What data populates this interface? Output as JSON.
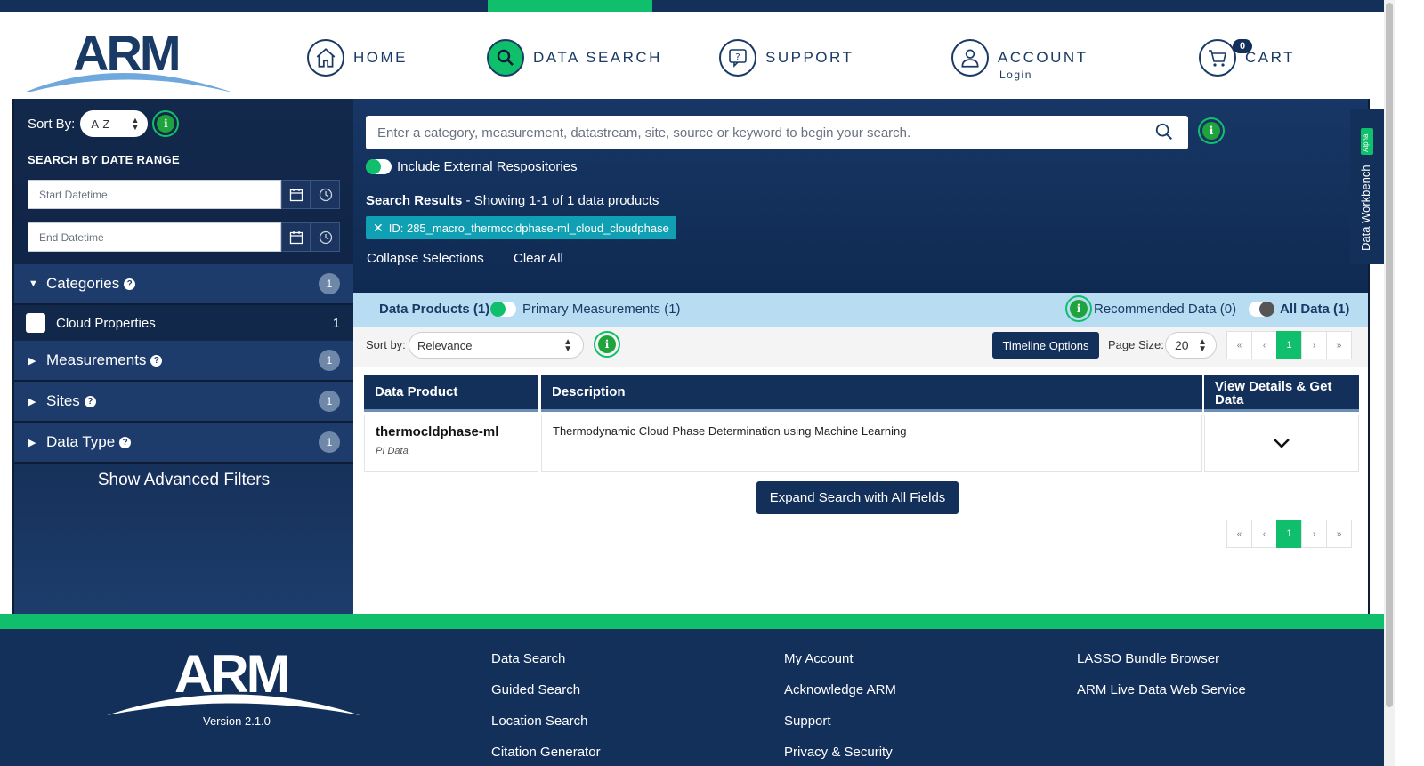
{
  "header": {
    "logo_text": "ARM",
    "nav": [
      {
        "label": "HOME"
      },
      {
        "label": "DATA SEARCH"
      },
      {
        "label": "SUPPORT"
      },
      {
        "label": "ACCOUNT",
        "sub": "Login"
      },
      {
        "label": "CART",
        "badge": "0"
      }
    ]
  },
  "sidebar": {
    "sort_label": "Sort By:",
    "sort_value": "A-Z",
    "date_title": "SEARCH BY DATE RANGE",
    "start_placeholder": "Start Datetime",
    "end_placeholder": "End Datetime",
    "facets": [
      {
        "name": "Categories",
        "count": "1",
        "expanded": true
      },
      {
        "name": "Measurements",
        "count": "1",
        "expanded": false
      },
      {
        "name": "Sites",
        "count": "1",
        "expanded": false
      },
      {
        "name": "Data Type",
        "count": "1",
        "expanded": false
      }
    ],
    "category_item": {
      "name": "Cloud Properties",
      "count": "1"
    },
    "advanced_filters": "Show Advanced Filters"
  },
  "search": {
    "placeholder": "Enter a category, measurement, datastream, site, source or keyword to begin your search.",
    "include_external": "Include External Respositories",
    "results_label": "Search Results",
    "results_summary": " - Showing 1-1 of 1 data products",
    "chip": "ID: 285_macro_thermocldphase-ml_cloud_cloudphase",
    "collapse": "Collapse Selections",
    "clear_all": "Clear All"
  },
  "tabs": {
    "data_products": "Data Products (1)",
    "primary_measurements": "Primary Measurements (1)",
    "recommended": "Recommended Data (0)",
    "all_data": "All Data (1)"
  },
  "sortbar": {
    "label": "Sort by:",
    "value": "Relevance",
    "timeline": "Timeline Options",
    "page_size_label": "Page Size:",
    "page_size": "20",
    "pager": [
      "«",
      "‹",
      "1",
      "›",
      "»"
    ]
  },
  "table": {
    "headers": [
      "Data Product",
      "Description",
      "View Details & Get Data"
    ],
    "rows": [
      {
        "name": "thermocldphase-ml",
        "tag": "PI Data",
        "description": "Thermodynamic Cloud Phase Determination using Machine Learning"
      }
    ]
  },
  "expand_button": "Expand Search with All Fields",
  "workbench": {
    "label": "Data Workbench",
    "badge": "Alpha"
  },
  "footer": {
    "logo_text": "ARM",
    "version": "Version 2.1.0",
    "col1": [
      "Data Search",
      "Guided Search",
      "Location Search",
      "Citation Generator"
    ],
    "col2": [
      "My Account",
      "Acknowledge ARM",
      "Support",
      "Privacy & Security"
    ],
    "col3": [
      "LASSO Bundle Browser",
      "ARM Live Data Web Service"
    ]
  },
  "colors": {
    "navy": "#13305a",
    "green": "#0fbf6b",
    "light_blue": "#b8ddf3",
    "teal": "#0fa0b3"
  }
}
